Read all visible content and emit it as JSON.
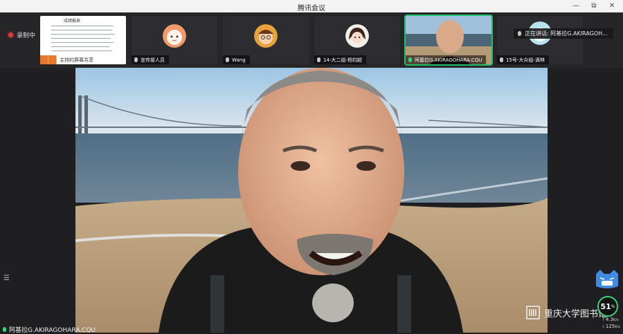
{
  "window": {
    "title": "腾讯会议"
  },
  "recording": {
    "label": "录制中"
  },
  "participants": [
    {
      "name": "主持的屏幕共享"
    },
    {
      "name": "宣传部人员"
    },
    {
      "name": "Wang"
    },
    {
      "name": "14-大二组-杨钧超"
    },
    {
      "name": "阿基拉G.AKIRAGOHARA.CQU"
    },
    {
      "name": "15号-大众组-滴林"
    }
  ],
  "shared_doc": {
    "title": "成绩报表"
  },
  "talking_indicator": {
    "text": "正在讲话: 阿基拉G.AKIRAGOH..."
  },
  "main_video": {
    "speaker_name": "阿基拉G.AKIRAGOHARA.CQU"
  },
  "watermark": {
    "text": "重庆大学图书馆"
  },
  "network_widget": {
    "quality": "51",
    "unit": "%",
    "upload": "4.3",
    "download": "125",
    "rate_unit": "K/s"
  },
  "colors": {
    "active_border": "#1fbf6a",
    "recording": "#e03b3b",
    "share_badge": "#e37a2d"
  }
}
